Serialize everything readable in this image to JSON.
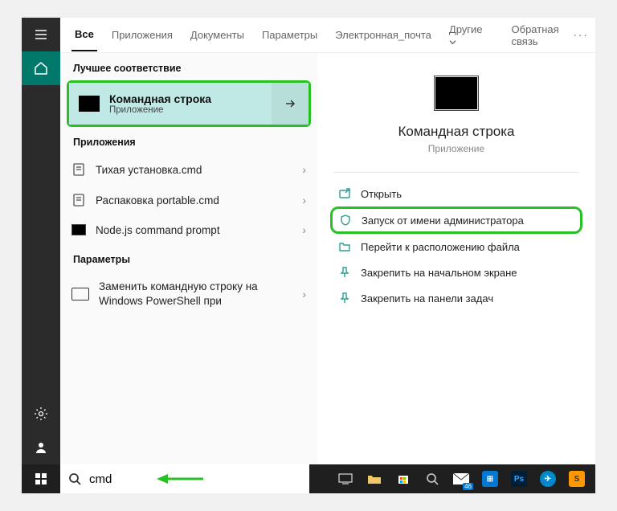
{
  "tabs": {
    "all": "Все",
    "apps": "Приложения",
    "docs": "Документы",
    "params": "Параметры",
    "email": "Электронная_почта",
    "other": "Другие",
    "feedback": "Обратная связь"
  },
  "sections": {
    "best_match": "Лучшее соответствие",
    "applications": "Приложения",
    "parameters": "Параметры"
  },
  "top_hit": {
    "title": "Командная строка",
    "subtitle": "Приложение"
  },
  "results": {
    "r1": "Тихая установка.cmd",
    "r2": "Распаковка portable.cmd",
    "r3": "Node.js command prompt",
    "p1": "Заменить командную строку на Windows PowerShell при"
  },
  "preview": {
    "title": "Командная строка",
    "subtitle": "Приложение"
  },
  "actions": {
    "open": "Открыть",
    "run_admin": "Запуск от имени администратора",
    "goto_location": "Перейти к расположению файла",
    "pin_start": "Закрепить на начальном экране",
    "pin_taskbar": "Закрепить на панели задач"
  },
  "search": {
    "query": "cmd"
  },
  "taskbar_badge": "46"
}
